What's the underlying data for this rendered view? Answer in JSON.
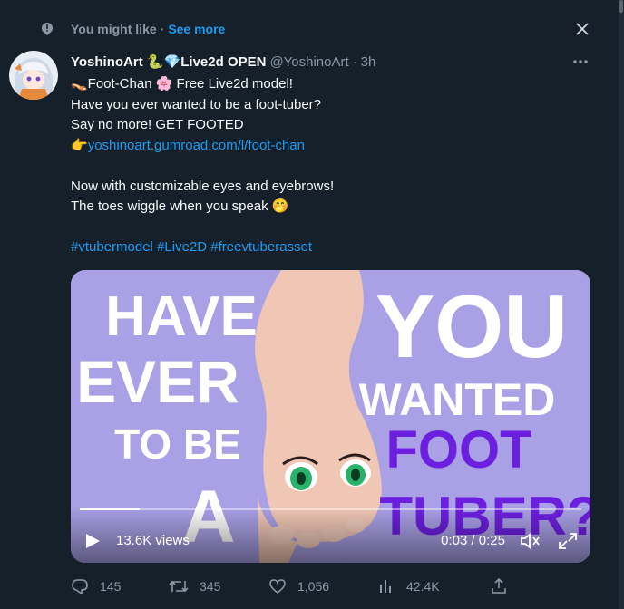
{
  "context": {
    "label": "You might like",
    "separator": "·",
    "see_more": "See more"
  },
  "tweet": {
    "display_name": "YoshinoArt 🐍💎Live2d OPEN",
    "handle": "@YoshinoArt",
    "separator": "·",
    "time": "3h",
    "lines": {
      "l1": "👡Foot-Chan 🌸 Free Live2d model!",
      "l2": "Have you ever wanted to be a foot-tuber?",
      "l3": "Say no more! GET FOOTED",
      "l4_emoji": "👉",
      "l4_link": "yoshinoart.gumroad.com/l/foot-chan",
      "l5": "Now with customizable eyes and eyebrows!",
      "l6": "The toes wiggle when you speak 🤭"
    },
    "hashtags": {
      "h1": "#vtubermodel",
      "h2": "#Live2D",
      "h3": "#freevtuberasset"
    }
  },
  "video": {
    "text_have": "HAVE",
    "text_ever": "EVER",
    "text_tobe": "TO BE",
    "text_a": "A",
    "text_you": "YOU",
    "text_wanted": "WANTED",
    "text_foot": "FOOT",
    "text_tuber": "TUBER?",
    "views": "13.6K views",
    "timecode": "0:03 / 0:25",
    "progress": 0.12
  },
  "metrics": {
    "replies": "145",
    "retweets": "345",
    "likes": "1,056",
    "views": "42.4K"
  },
  "colors": {
    "background": "#15202b",
    "accent": "#1d9bf0",
    "muted": "#8b98a5",
    "video_bg": "#a9a0e6",
    "purple_text": "#6d1fe0"
  },
  "icons": [
    "sparkle-icon",
    "close-icon",
    "more-icon",
    "play-icon",
    "volume-icon",
    "fullscreen-icon",
    "reply-icon",
    "retweet-icon",
    "like-icon",
    "views-icon",
    "share-icon"
  ]
}
